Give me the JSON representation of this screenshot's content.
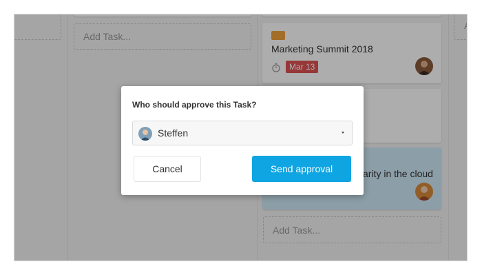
{
  "board": {
    "add_task_label": "Add Task...",
    "right_column_partial_label": "A",
    "cards": [
      {
        "title": "Marketing Summit 2018",
        "due_date": "Mar 13",
        "tag_color": "#f0a33c",
        "date_color": "#e05252",
        "avatar": "person-avatar"
      },
      {
        "title_visible_fragment": "arity in the cloud",
        "background_color": "#cfe9f6",
        "avatar": "person-avatar"
      }
    ]
  },
  "dialog": {
    "title": "Who should approve this Task?",
    "approver_select": {
      "selected_value": "Steffen",
      "avatar": "user-avatar"
    },
    "cancel_label": "Cancel",
    "send_label": "Send approval",
    "send_color": "#0ea5e2"
  }
}
